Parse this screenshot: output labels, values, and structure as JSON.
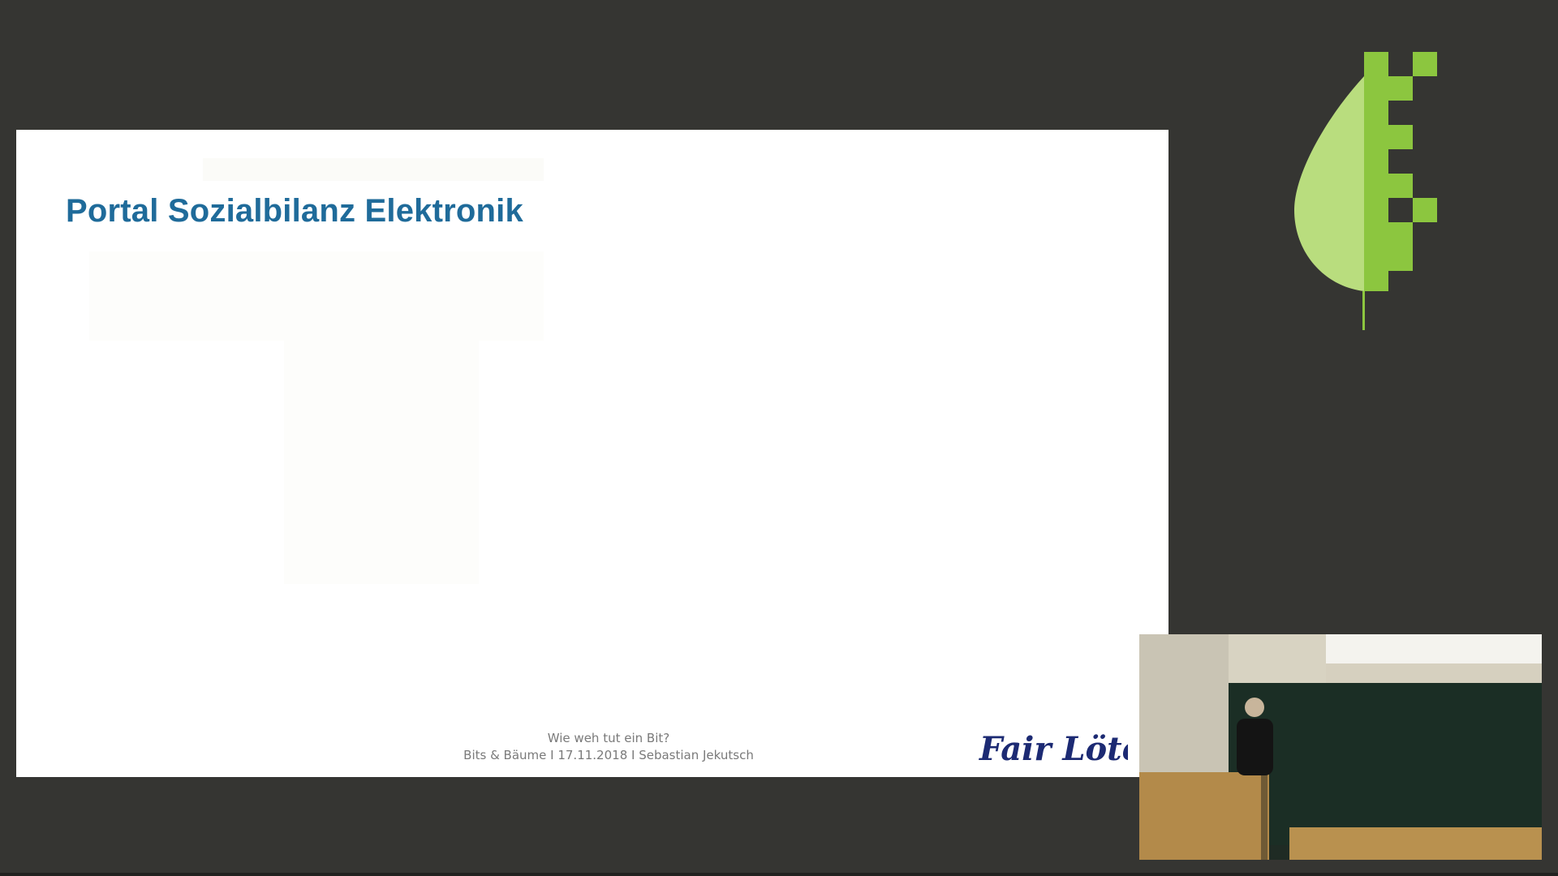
{
  "slide": {
    "title": "Portal Sozialbilanz Elektronik",
    "footer": {
      "line1": "Wie weh tut ein Bit?",
      "line2": "Bits & Bäume I  17.11.2018  I Sebastian Jekutsch"
    },
    "logo_text": "Fair Lötet"
  },
  "colors": {
    "background": "#353532",
    "slide_background": "#ffffff",
    "title": "#1f6b9a",
    "footer_text": "#7a7a7a",
    "fairloetet_logo": "#1c2a73",
    "leaf_light": "#b9dd7e",
    "leaf_dark": "#8cc63f"
  },
  "icons": {
    "conference_logo": "leaf-pixel-icon",
    "fairloetet_logo": "fairloetet-logo"
  }
}
